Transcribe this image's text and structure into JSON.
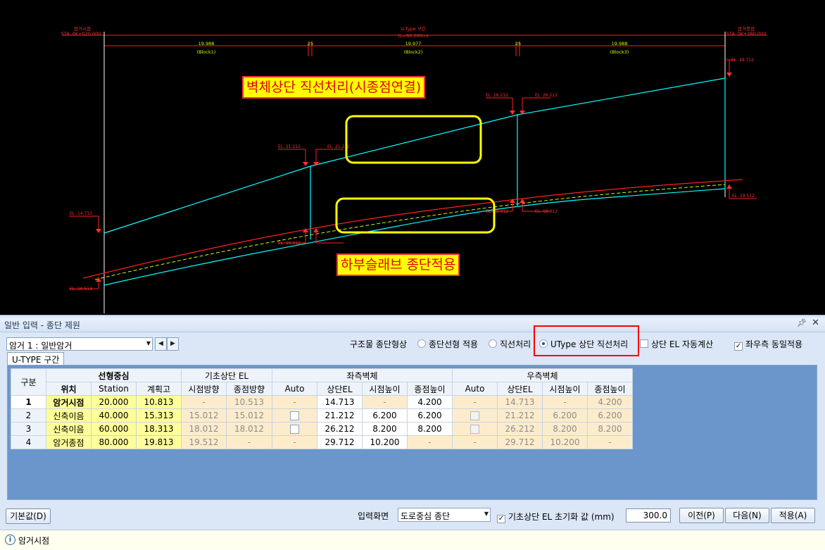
{
  "drawing": {
    "start_title": "암거시점",
    "start_sta": "STA. 0K+020.000",
    "end_title": "암거종점",
    "end_sta": "STA. 0K+080.000",
    "utype_title": "U-Type 구간",
    "utype_len": "(L=60.000m)",
    "block1_len": "19.988",
    "block1": "(Block1)",
    "block2_len": "19.977",
    "block2": "(Block2)",
    "block3_len": "19.988",
    "block3": "(Block3)",
    "joint1": "25",
    "joint2": "25",
    "el_29712": "EL. 29.712",
    "el_26212a": "EL. 26.212",
    "el_26212b": "EL. 26.212",
    "el_21212a": "EL. 21.212",
    "el_21212b": "EL. 21.212",
    "el_14713": "EL. 14.713",
    "el_15012a": "EL. 15.012",
    "el_15013": "EL. 15.013",
    "el_18012a": "EL. 18.012",
    "el_18012b": "EL. 18.012",
    "el_19512": "EL. 19.512",
    "el_10513": "EL. 10.513",
    "annotation_top": "벽체상단 직선처리(시종점연결)",
    "annotation_bottom": "하부슬래브 종단적용",
    "colors": {
      "wall": "#00ffff",
      "ground": "#ff2020",
      "guide": "#c8ff00",
      "highlight": "#ffff00",
      "callout": "#ff0000"
    }
  },
  "panel": {
    "title": "일반 입력 - 종단 제원",
    "pin_icon": "pin-icon",
    "close_icon": "close-icon",
    "culvert_select": "암거 1 : 일반암거",
    "shape_label": "구조물 종단형상",
    "radio_profile": "종단선형 적용",
    "radio_straight": "직선처리",
    "radio_utype": "UType 상단 직선처리",
    "chk_auto_el": "상단 EL 자동계산",
    "chk_same": "좌우측 동일적용",
    "tab_utype": "U-TYPE 구간",
    "grid": {
      "h_gubun": "구분",
      "h_center": "선형중심",
      "h_base": "기초상단 EL",
      "h_left": "좌측벽체",
      "h_right": "우측벽체",
      "h_pos": "위치",
      "h_station": "Station",
      "h_plan": "계획고",
      "h_start_dir": "시점방향",
      "h_end_dir": "종점방향",
      "h_auto_l": "Auto",
      "h_top_el_l": "상단EL",
      "h_start_h_l": "시점높이",
      "h_end_h_l": "종점높이",
      "h_auto_r": "Auto",
      "h_top_el_r": "상단EL",
      "h_start_h_r": "시점높이",
      "h_end_h_r": "종점높이",
      "rows": [
        {
          "no": "1",
          "pos": "암거시점",
          "station": "20.000",
          "plan": "10.813",
          "base_start": "-",
          "base_end": "10.513",
          "l_auto": "-",
          "l_top": "14.713",
          "l_start": "-",
          "l_end": "4.200",
          "r_auto": "-",
          "r_top": "14.713",
          "r_start": "-",
          "r_end": "4.200"
        },
        {
          "no": "2",
          "pos": "신축이음",
          "station": "40.000",
          "plan": "15.313",
          "base_start": "15.012",
          "base_end": "15.012",
          "l_auto": "",
          "l_top": "21.212",
          "l_start": "6.200",
          "l_end": "6.200",
          "r_auto": "",
          "r_top": "21.212",
          "r_start": "6.200",
          "r_end": "6.200"
        },
        {
          "no": "3",
          "pos": "신축이음",
          "station": "60.000",
          "plan": "18.313",
          "base_start": "18.012",
          "base_end": "18.012",
          "l_auto": "",
          "l_top": "26.212",
          "l_start": "8.200",
          "l_end": "8.200",
          "r_auto": "",
          "r_top": "26.212",
          "r_start": "8.200",
          "r_end": "8.200"
        },
        {
          "no": "4",
          "pos": "암거종점",
          "station": "80.000",
          "plan": "19.813",
          "base_start": "19.512",
          "base_end": "-",
          "l_auto": "-",
          "l_top": "29.712",
          "l_start": "10.200",
          "l_end": "-",
          "r_auto": "-",
          "r_top": "29.712",
          "r_start": "10.200",
          "r_end": "-"
        }
      ]
    },
    "btn_default": "기본값(D)",
    "input_screen_label": "입력화면",
    "input_screen_value": "도로중심 종단",
    "chk_init_label": "기초상단 EL 초기화 값 (mm)",
    "init_value": "300.0",
    "btn_prev": "이전(P)",
    "btn_next": "다음(N)",
    "btn_apply": "적용(A)",
    "status_icon": "info-icon",
    "status_text": "암거시점"
  }
}
